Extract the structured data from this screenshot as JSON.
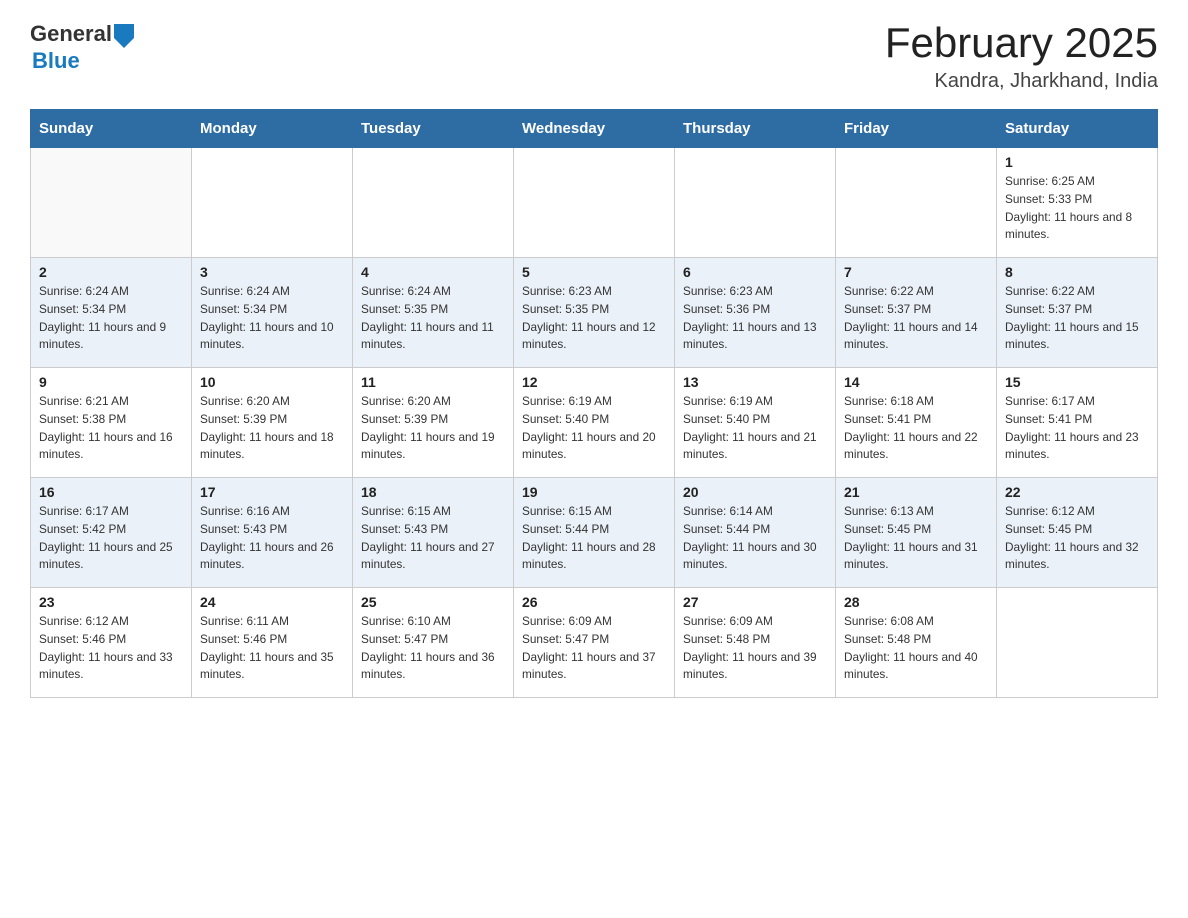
{
  "header": {
    "logo_general": "General",
    "logo_blue": "Blue",
    "title": "February 2025",
    "subtitle": "Kandra, Jharkhand, India"
  },
  "weekdays": [
    "Sunday",
    "Monday",
    "Tuesday",
    "Wednesday",
    "Thursday",
    "Friday",
    "Saturday"
  ],
  "weeks": [
    {
      "id": "week1",
      "days": [
        {
          "num": "",
          "info": ""
        },
        {
          "num": "",
          "info": ""
        },
        {
          "num": "",
          "info": ""
        },
        {
          "num": "",
          "info": ""
        },
        {
          "num": "",
          "info": ""
        },
        {
          "num": "",
          "info": ""
        },
        {
          "num": "1",
          "info": "Sunrise: 6:25 AM\nSunset: 5:33 PM\nDaylight: 11 hours and 8 minutes."
        }
      ]
    },
    {
      "id": "week2",
      "days": [
        {
          "num": "2",
          "info": "Sunrise: 6:24 AM\nSunset: 5:34 PM\nDaylight: 11 hours and 9 minutes."
        },
        {
          "num": "3",
          "info": "Sunrise: 6:24 AM\nSunset: 5:34 PM\nDaylight: 11 hours and 10 minutes."
        },
        {
          "num": "4",
          "info": "Sunrise: 6:24 AM\nSunset: 5:35 PM\nDaylight: 11 hours and 11 minutes."
        },
        {
          "num": "5",
          "info": "Sunrise: 6:23 AM\nSunset: 5:35 PM\nDaylight: 11 hours and 12 minutes."
        },
        {
          "num": "6",
          "info": "Sunrise: 6:23 AM\nSunset: 5:36 PM\nDaylight: 11 hours and 13 minutes."
        },
        {
          "num": "7",
          "info": "Sunrise: 6:22 AM\nSunset: 5:37 PM\nDaylight: 11 hours and 14 minutes."
        },
        {
          "num": "8",
          "info": "Sunrise: 6:22 AM\nSunset: 5:37 PM\nDaylight: 11 hours and 15 minutes."
        }
      ]
    },
    {
      "id": "week3",
      "days": [
        {
          "num": "9",
          "info": "Sunrise: 6:21 AM\nSunset: 5:38 PM\nDaylight: 11 hours and 16 minutes."
        },
        {
          "num": "10",
          "info": "Sunrise: 6:20 AM\nSunset: 5:39 PM\nDaylight: 11 hours and 18 minutes."
        },
        {
          "num": "11",
          "info": "Sunrise: 6:20 AM\nSunset: 5:39 PM\nDaylight: 11 hours and 19 minutes."
        },
        {
          "num": "12",
          "info": "Sunrise: 6:19 AM\nSunset: 5:40 PM\nDaylight: 11 hours and 20 minutes."
        },
        {
          "num": "13",
          "info": "Sunrise: 6:19 AM\nSunset: 5:40 PM\nDaylight: 11 hours and 21 minutes."
        },
        {
          "num": "14",
          "info": "Sunrise: 6:18 AM\nSunset: 5:41 PM\nDaylight: 11 hours and 22 minutes."
        },
        {
          "num": "15",
          "info": "Sunrise: 6:17 AM\nSunset: 5:41 PM\nDaylight: 11 hours and 23 minutes."
        }
      ]
    },
    {
      "id": "week4",
      "days": [
        {
          "num": "16",
          "info": "Sunrise: 6:17 AM\nSunset: 5:42 PM\nDaylight: 11 hours and 25 minutes."
        },
        {
          "num": "17",
          "info": "Sunrise: 6:16 AM\nSunset: 5:43 PM\nDaylight: 11 hours and 26 minutes."
        },
        {
          "num": "18",
          "info": "Sunrise: 6:15 AM\nSunset: 5:43 PM\nDaylight: 11 hours and 27 minutes."
        },
        {
          "num": "19",
          "info": "Sunrise: 6:15 AM\nSunset: 5:44 PM\nDaylight: 11 hours and 28 minutes."
        },
        {
          "num": "20",
          "info": "Sunrise: 6:14 AM\nSunset: 5:44 PM\nDaylight: 11 hours and 30 minutes."
        },
        {
          "num": "21",
          "info": "Sunrise: 6:13 AM\nSunset: 5:45 PM\nDaylight: 11 hours and 31 minutes."
        },
        {
          "num": "22",
          "info": "Sunrise: 6:12 AM\nSunset: 5:45 PM\nDaylight: 11 hours and 32 minutes."
        }
      ]
    },
    {
      "id": "week5",
      "days": [
        {
          "num": "23",
          "info": "Sunrise: 6:12 AM\nSunset: 5:46 PM\nDaylight: 11 hours and 33 minutes."
        },
        {
          "num": "24",
          "info": "Sunrise: 6:11 AM\nSunset: 5:46 PM\nDaylight: 11 hours and 35 minutes."
        },
        {
          "num": "25",
          "info": "Sunrise: 6:10 AM\nSunset: 5:47 PM\nDaylight: 11 hours and 36 minutes."
        },
        {
          "num": "26",
          "info": "Sunrise: 6:09 AM\nSunset: 5:47 PM\nDaylight: 11 hours and 37 minutes."
        },
        {
          "num": "27",
          "info": "Sunrise: 6:09 AM\nSunset: 5:48 PM\nDaylight: 11 hours and 39 minutes."
        },
        {
          "num": "28",
          "info": "Sunrise: 6:08 AM\nSunset: 5:48 PM\nDaylight: 11 hours and 40 minutes."
        },
        {
          "num": "",
          "info": ""
        }
      ]
    }
  ]
}
